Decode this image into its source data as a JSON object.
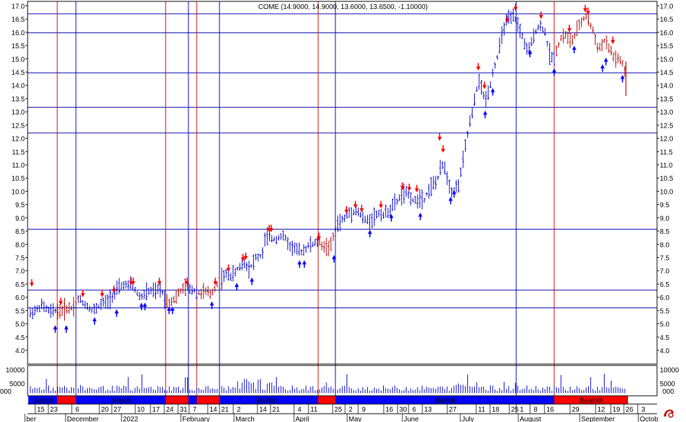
{
  "chart_data": {
    "type": "bar",
    "subtype": "ohlc",
    "title": "COME (14.9000, 14.9000, 13.6000, 13.6500, -1.10000)",
    "symbol": "COME",
    "last_bar": {
      "open": 14.9,
      "high": 14.9,
      "low": 13.6,
      "close": 13.65,
      "change": -1.1
    },
    "ylim": [
      3.5,
      17.1
    ],
    "y_ticks": [
      "4.0",
      "4.5",
      "5.0",
      "5.5",
      "6.0",
      "6.5",
      "7.0",
      "7.5",
      "8.0",
      "8.5",
      "9.0",
      "9.5",
      "10.0",
      "10.5",
      "11.0",
      "11.5",
      "12.0",
      "12.5",
      "13.0",
      "13.5",
      "14.0",
      "14.5",
      "15.0",
      "15.5",
      "16.0",
      "16.5",
      "17.0"
    ],
    "volume_ticks": [
      "5000",
      "10000"
    ],
    "volume_axis_stub_left": "000",
    "volume_axis_stub_right": "000",
    "horizontal_lines": [
      16.7,
      15.98,
      14.47,
      13.17,
      12.2,
      8.57,
      6.27,
      5.6
    ],
    "x_day_labels": [
      "15",
      "23",
      "6",
      "20",
      "27",
      "10",
      "17",
      "24",
      "31",
      "7",
      "14",
      "21",
      "2",
      "14",
      "21",
      "4",
      "11",
      "25",
      "2",
      "9",
      "16",
      "30",
      "6",
      "13",
      "27",
      "11",
      "18",
      "25",
      "1",
      "8",
      "16",
      "29",
      "12",
      "19",
      "26",
      "3"
    ],
    "x_month_labels": [
      "ber",
      "December",
      "2022",
      "February",
      "March",
      "April",
      "May",
      "June",
      "July",
      "August",
      "September",
      "Octob"
    ],
    "band_labels": [
      "Bullish",
      "Bullish",
      "Bullish",
      "Bullish",
      "Bearish"
    ],
    "band_colors": {
      "bullish": "#0000ff",
      "bearish": "#ff0000"
    },
    "series_color_bull": "#0000cc",
    "series_color_bear": "#b00000",
    "key": [
      [
        5,
        6.3
      ],
      [
        10,
        5.9
      ],
      [
        15,
        5.8
      ],
      [
        20,
        5.6
      ],
      [
        25,
        5.5
      ],
      [
        30,
        5.3
      ],
      [
        35,
        5.25
      ],
      [
        40,
        5.25
      ],
      [
        45,
        5.4
      ],
      [
        50,
        5.5
      ],
      [
        55,
        5.55
      ],
      [
        60,
        5.7
      ],
      [
        65,
        5.6
      ],
      [
        70,
        5.5
      ],
      [
        75,
        5.45
      ],
      [
        80,
        5.5
      ],
      [
        85,
        5.45
      ],
      [
        90,
        5.5
      ],
      [
        95,
        5.55
      ],
      [
        100,
        5.6
      ],
      [
        105,
        5.6
      ],
      [
        110,
        5.9
      ],
      [
        115,
        5.95
      ],
      [
        120,
        5.8
      ],
      [
        125,
        5.7
      ],
      [
        130,
        5.6
      ],
      [
        135,
        5.5
      ],
      [
        140,
        5.6
      ],
      [
        145,
        5.7
      ],
      [
        150,
        5.8
      ],
      [
        155,
        5.8
      ],
      [
        160,
        6.0
      ],
      [
        165,
        6.1
      ],
      [
        170,
        6.3
      ],
      [
        175,
        6.4
      ],
      [
        180,
        6.5
      ],
      [
        185,
        6.4
      ],
      [
        190,
        6.5
      ],
      [
        195,
        6.3
      ],
      [
        200,
        6.1
      ],
      [
        205,
        6.0
      ],
      [
        210,
        6.15
      ],
      [
        215,
        6.2
      ],
      [
        220,
        6.25
      ],
      [
        225,
        6.2
      ],
      [
        230,
        6.3
      ],
      [
        235,
        6.2
      ],
      [
        240,
        5.9
      ],
      [
        245,
        5.8
      ],
      [
        250,
        5.9
      ],
      [
        255,
        6.0
      ],
      [
        260,
        6.2
      ],
      [
        265,
        6.3
      ],
      [
        270,
        6.4
      ],
      [
        275,
        6.3
      ],
      [
        280,
        6.3
      ],
      [
        285,
        6.2
      ],
      [
        290,
        6.15
      ],
      [
        295,
        6.2
      ],
      [
        300,
        6.2
      ],
      [
        305,
        6.1
      ],
      [
        310,
        6.3
      ],
      [
        315,
        6.5
      ],
      [
        320,
        6.7
      ],
      [
        325,
        6.8
      ],
      [
        330,
        6.9
      ],
      [
        335,
        6.8
      ],
      [
        340,
        6.9
      ],
      [
        345,
        7.1
      ],
      [
        350,
        7.2
      ],
      [
        355,
        7.3
      ],
      [
        360,
        7.1
      ],
      [
        365,
        7.2
      ],
      [
        370,
        7.5
      ],
      [
        375,
        7.5
      ],
      [
        380,
        7.6
      ],
      [
        385,
        8.3
      ],
      [
        390,
        8.3
      ],
      [
        395,
        8.2
      ],
      [
        400,
        8.2
      ],
      [
        405,
        8.3
      ],
      [
        410,
        8.3
      ],
      [
        415,
        8.2
      ],
      [
        420,
        7.9
      ],
      [
        425,
        7.9
      ],
      [
        430,
        7.8
      ],
      [
        435,
        7.7
      ],
      [
        440,
        7.8
      ],
      [
        445,
        7.9
      ],
      [
        450,
        8.0
      ],
      [
        455,
        8.0
      ],
      [
        460,
        8.1
      ],
      [
        465,
        8.0
      ],
      [
        470,
        7.9
      ],
      [
        475,
        7.9
      ],
      [
        480,
        7.95
      ],
      [
        485,
        8.5
      ],
      [
        490,
        8.8
      ],
      [
        495,
        8.9
      ],
      [
        500,
        9.0
      ],
      [
        505,
        9.2
      ],
      [
        510,
        9.2
      ],
      [
        515,
        9.3
      ],
      [
        520,
        9.2
      ],
      [
        525,
        9.0
      ],
      [
        530,
        8.9
      ],
      [
        535,
        8.9
      ],
      [
        540,
        9.0
      ],
      [
        545,
        9.1
      ],
      [
        550,
        9.2
      ],
      [
        555,
        9.1
      ],
      [
        560,
        9.2
      ],
      [
        565,
        9.3
      ],
      [
        570,
        9.5
      ],
      [
        575,
        9.6
      ],
      [
        580,
        9.8
      ],
      [
        585,
        9.9
      ],
      [
        590,
        9.9
      ],
      [
        595,
        9.8
      ],
      [
        600,
        9.6
      ],
      [
        605,
        9.7
      ],
      [
        610,
        9.8
      ],
      [
        615,
        9.7
      ],
      [
        620,
        10.0
      ],
      [
        625,
        10.2
      ],
      [
        630,
        10.3
      ],
      [
        635,
        10.5
      ],
      [
        640,
        11.0
      ],
      [
        645,
        10.9
      ],
      [
        650,
        10.3
      ],
      [
        655,
        10.0
      ],
      [
        660,
        10.1
      ],
      [
        665,
        10.3
      ],
      [
        670,
        11.0
      ],
      [
        675,
        11.8
      ],
      [
        680,
        12.5
      ],
      [
        685,
        13.0
      ],
      [
        690,
        13.8
      ],
      [
        695,
        14.2
      ],
      [
        700,
        13.6
      ],
      [
        705,
        13.5
      ],
      [
        710,
        14.0
      ],
      [
        715,
        14.6
      ],
      [
        720,
        15.0
      ],
      [
        725,
        15.6
      ],
      [
        730,
        16.2
      ],
      [
        735,
        16.5
      ],
      [
        740,
        16.5
      ],
      [
        745,
        16.6
      ],
      [
        750,
        16.3
      ],
      [
        755,
        16.0
      ],
      [
        760,
        15.6
      ],
      [
        765,
        15.2
      ],
      [
        770,
        15.6
      ],
      [
        775,
        16.0
      ],
      [
        780,
        16.2
      ],
      [
        785,
        16.2
      ],
      [
        790,
        16.0
      ],
      [
        795,
        15.3
      ],
      [
        800,
        15.0
      ],
      [
        805,
        15.2
      ],
      [
        810,
        15.6
      ],
      [
        815,
        15.9
      ],
      [
        820,
        15.9
      ],
      [
        825,
        15.7
      ],
      [
        830,
        15.7
      ],
      [
        835,
        16.0
      ],
      [
        840,
        16.3
      ],
      [
        845,
        16.5
      ],
      [
        850,
        16.6
      ],
      [
        855,
        16.3
      ],
      [
        860,
        16.0
      ],
      [
        865,
        15.5
      ],
      [
        870,
        15.4
      ],
      [
        875,
        15.7
      ],
      [
        880,
        15.5
      ],
      [
        885,
        15.3
      ],
      [
        890,
        15.0
      ],
      [
        895,
        15.0
      ],
      [
        900,
        14.9
      ],
      [
        905,
        14.6
      ],
      [
        907,
        13.65
      ]
    ]
  }
}
